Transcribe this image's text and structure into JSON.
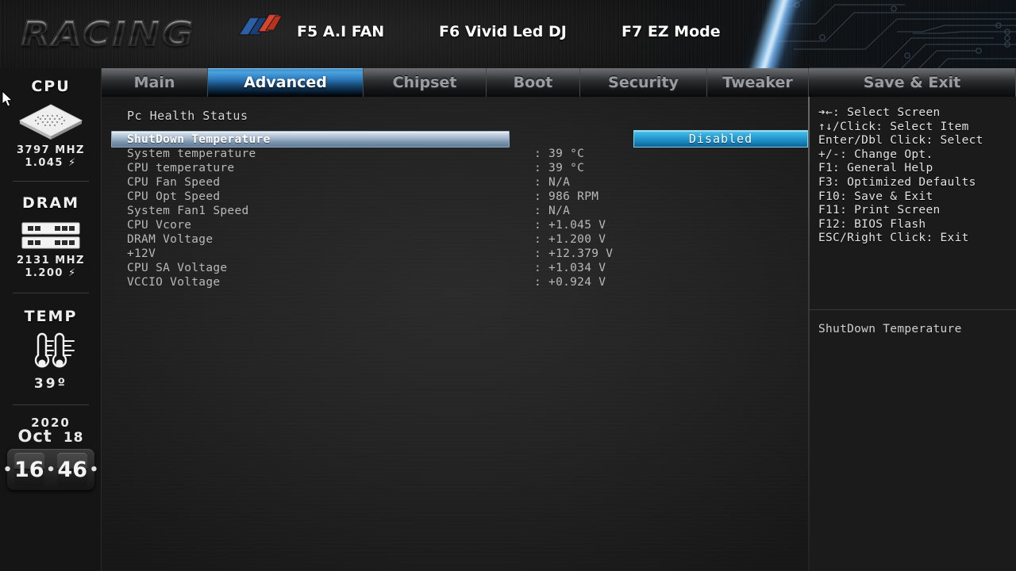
{
  "header": {
    "logo_text": "RACING",
    "logo_emblem_icon": "racing-flag-emblem",
    "hotkeys": [
      {
        "label": "F5 A.I FAN"
      },
      {
        "label": "F6 Vivid Led DJ"
      },
      {
        "label": "F7 EZ Mode"
      }
    ]
  },
  "tabs": [
    {
      "label": "Main",
      "active": false
    },
    {
      "label": "Advanced",
      "active": true
    },
    {
      "label": "Chipset",
      "active": false
    },
    {
      "label": "Boot",
      "active": false
    },
    {
      "label": "Security",
      "active": false
    },
    {
      "label": "Tweaker",
      "active": false
    },
    {
      "label": "Save & Exit",
      "active": false
    }
  ],
  "sidebar": {
    "cpu": {
      "title": "CPU",
      "icon": "cpu-chip-icon",
      "frequency": "3797 MHZ",
      "voltage": "1.045"
    },
    "dram": {
      "title": "DRAM",
      "icon": "dram-module-icon",
      "frequency": "2131 MHZ",
      "voltage": "1.200"
    },
    "temp": {
      "title": "TEMP",
      "icon": "thermometer-icon",
      "value": "39º"
    },
    "datetime": {
      "year": "2020",
      "month": "Oct",
      "day": "18",
      "hours": "16",
      "minutes": "46"
    }
  },
  "main": {
    "section_title": "Pc Health Status",
    "rows": [
      {
        "label": "ShutDown Temperature",
        "value": "",
        "selected": true,
        "option": "Disabled"
      },
      {
        "label": "System temperature",
        "value": ": 39 °C",
        "selected": false
      },
      {
        "label": "CPU temperature",
        "value": ": 39 °C",
        "selected": false
      },
      {
        "label": "CPU Fan Speed",
        "value": ": N/A",
        "selected": false
      },
      {
        "label": "CPU Opt Speed",
        "value": ": 986 RPM",
        "selected": false
      },
      {
        "label": "System Fan1 Speed",
        "value": ": N/A",
        "selected": false
      },
      {
        "label": "CPU Vcore",
        "value": ": +1.045 V",
        "selected": false
      },
      {
        "label": "DRAM Voltage",
        "value": ": +1.200 V",
        "selected": false
      },
      {
        "label": "+12V",
        "value": ": +12.379 V",
        "selected": false
      },
      {
        "label": "CPU SA Voltage",
        "value": ": +1.034 V",
        "selected": false
      },
      {
        "label": "VCCIO Voltage",
        "value": ": +0.924 V",
        "selected": false
      }
    ]
  },
  "help": {
    "keys": [
      "➔←: Select Screen",
      "↑↓/Click: Select Item",
      "Enter/Dbl Click: Select",
      "+/-: Change Opt.",
      "F1: General Help",
      "F3: Optimized Defaults",
      "F10: Save & Exit",
      "F11: Print Screen",
      "F12: BIOS Flash",
      "ESC/Right Click: Exit"
    ],
    "description": "ShutDown Temperature"
  },
  "colors": {
    "accent_blue": "#2b8fce",
    "option_box": "#38aede",
    "tab_active": "#2f7fc4",
    "text_primary": "#e3e3e3",
    "text_dim": "#b9b9b9"
  }
}
